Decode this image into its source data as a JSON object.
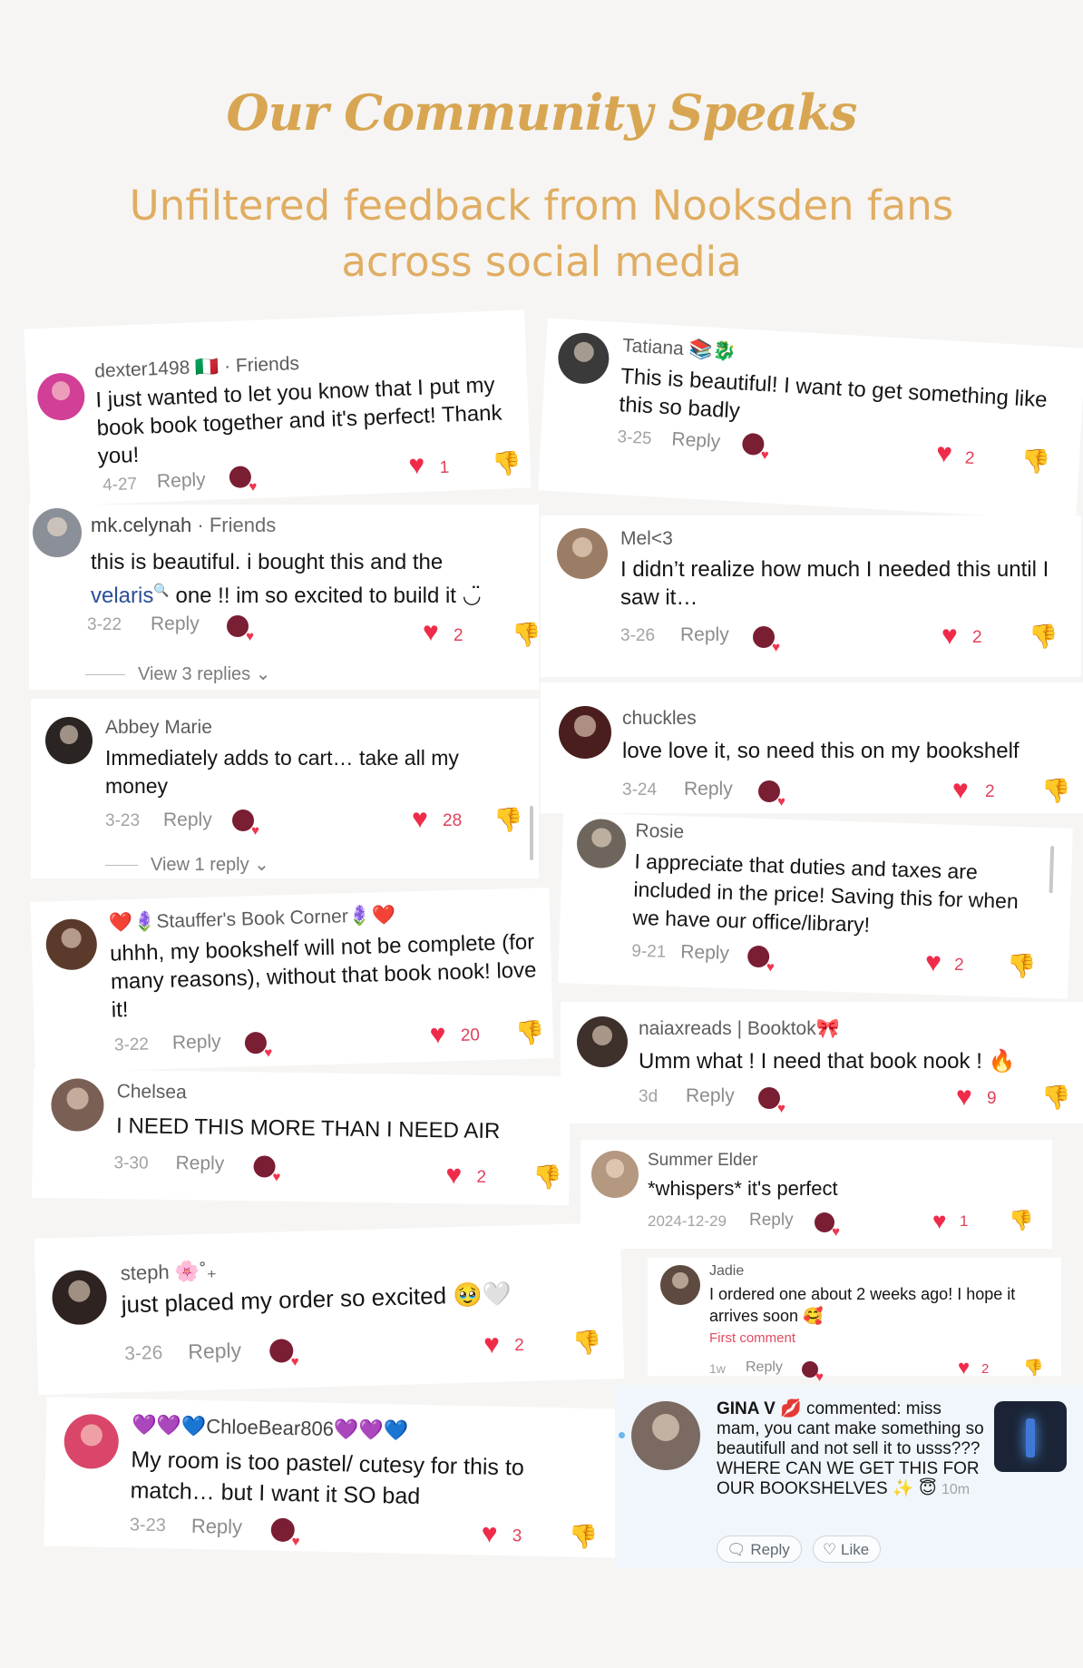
{
  "header": {
    "title": "Our Community Speaks",
    "subtitle_line1": "Unfiltered feedback from Nooksden fans",
    "subtitle_line2": "across social media"
  },
  "ui": {
    "reply": "Reply",
    "like": "Like",
    "heart_icon": "heart-icon",
    "dislike_icon": "thumbs-down-icon"
  },
  "colors": {
    "accent": "#d8a653",
    "like": "#ee2c4a",
    "link": "#2b4f97"
  },
  "comments": [
    {
      "name": "dexter1498 🇮🇹 · Friends",
      "text": "I just wanted to let you know that I put my book book together and it's perfect! Thank you!",
      "date": "4-27",
      "likes": "1"
    },
    {
      "name": "Tatiana 📚🐉",
      "text": "This is beautiful! I want to get something like this so badly",
      "date": "3-25",
      "likes": "2"
    },
    {
      "name": "mk.celynah",
      "name_suffix": " · Friends",
      "text_a": "this is beautiful. i bought this and the",
      "tag": "velaris",
      "text_b": " one !! im so excited to build it ◡̈",
      "date": "3-22",
      "likes": "2",
      "view_replies": "View 3 replies"
    },
    {
      "name": "Mel<3",
      "text": "I didn’t realize how much I needed this until I saw it…",
      "date": "3-26",
      "likes": "2"
    },
    {
      "name": "Abbey Marie",
      "text": "Immediately adds to cart… take all my money",
      "date": "3-23",
      "likes": "28",
      "view_replies": "View 1 reply"
    },
    {
      "name": "chuckles",
      "text": "love love it, so need this on my bookshelf",
      "date": "3-24",
      "likes": "2"
    },
    {
      "name": "❤️🪻Stauffer's Book Corner🪻❤️",
      "text": "uhhh, my bookshelf will not be complete (for many reasons), without that book nook! love it!",
      "date": "3-22",
      "likes": "20"
    },
    {
      "name": "Rosie",
      "text": "I appreciate that duties and taxes are included in the price! Saving this for when we have our office/library!",
      "date": "9-21",
      "likes": "2"
    },
    {
      "name": "Chelsea",
      "text": "I NEED THIS MORE THAN I NEED AIR",
      "date": "3-30",
      "likes": "2"
    },
    {
      "name": "naiaxreads | Booktok🎀",
      "text": "Umm what ! I need that book nook ! 🔥",
      "date": "3d",
      "likes": "9"
    },
    {
      "name": "Summer Elder",
      "text": "*whispers* it's perfect",
      "date": "2024-12-29",
      "likes": "1"
    },
    {
      "name": "steph 🌸˚₊",
      "text": "just placed my order so excited 🥹🤍",
      "date": "3-26",
      "likes": "2"
    },
    {
      "name": "Jadie",
      "text": "I ordered one about 2 weeks ago! I hope it arrives soon 🥰",
      "first_comment": "First comment",
      "date": "1w",
      "likes": "2"
    },
    {
      "name": "💜💜💙ChloeBear806💜💜💙",
      "text": "My room is too pastel/ cutesy for this to match… but I want it SO bad",
      "date": "3-23",
      "likes": "3"
    },
    {
      "name": "GINA V 💋",
      "action": " commented: ",
      "text": "miss mam, you cant make something so beautifull and not sell it to usss??? WHERE CAN WE GET THIS FOR OUR BOOKSHELVES ✨ 😇",
      "date": "10m"
    }
  ]
}
